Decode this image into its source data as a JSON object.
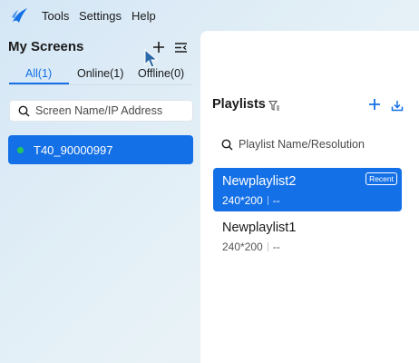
{
  "menu": {
    "items": [
      "Tools",
      "Settings",
      "Help"
    ]
  },
  "screens_panel": {
    "title": "My Screens",
    "tabs": [
      {
        "label": "All(1)",
        "active": true
      },
      {
        "label": "Online(1)",
        "active": false
      },
      {
        "label": "Offline(0)",
        "active": false
      }
    ],
    "search_placeholder": "Screen Name/IP Address",
    "screens": [
      {
        "name": "T40_90000997",
        "status": "online",
        "selected": true
      }
    ]
  },
  "playlists_panel": {
    "title": "Playlists",
    "search_placeholder": "Playlist Name/Resolution",
    "playlists": [
      {
        "name": "Newplaylist2",
        "resolution": "240*200",
        "extra": "--",
        "badge": "Recent",
        "selected": true
      },
      {
        "name": "Newplaylist1",
        "resolution": "240*200",
        "extra": "--",
        "badge": "",
        "selected": false
      }
    ]
  },
  "colors": {
    "accent": "#1470e6",
    "online": "#22c55e"
  }
}
